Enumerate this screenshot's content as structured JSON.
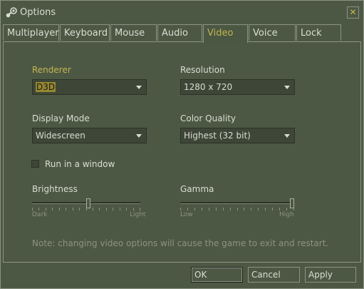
{
  "window": {
    "title": "Options"
  },
  "tabs": [
    {
      "label": "Multiplayer"
    },
    {
      "label": "Keyboard"
    },
    {
      "label": "Mouse"
    },
    {
      "label": "Audio"
    },
    {
      "label": "Video",
      "active": true
    },
    {
      "label": "Voice"
    },
    {
      "label": "Lock"
    }
  ],
  "video": {
    "renderer_label": "Renderer",
    "renderer_value": "D3D",
    "resolution_label": "Resolution",
    "resolution_value": "1280 x 720",
    "display_mode_label": "Display Mode",
    "display_mode_value": "Widescreen",
    "color_quality_label": "Color Quality",
    "color_quality_value": "Highest (32 bit)",
    "run_in_window_label": "Run in a window",
    "run_in_window_checked": false,
    "brightness_label": "Brightness",
    "brightness_min": "Dark",
    "brightness_max": "Light",
    "brightness_value": 0.52,
    "gamma_label": "Gamma",
    "gamma_min": "Low",
    "gamma_max": "High",
    "gamma_value": 1.0,
    "note": "Note: changing video options will cause the game to exit and restart."
  },
  "buttons": {
    "ok": "OK",
    "cancel": "Cancel",
    "apply": "Apply"
  },
  "colors": {
    "background": "#4c5844",
    "accent": "#c4b550",
    "text": "#d8ded3",
    "muted": "#8c9284"
  },
  "icons": {
    "app": "steam-icon",
    "close": "close-icon"
  }
}
